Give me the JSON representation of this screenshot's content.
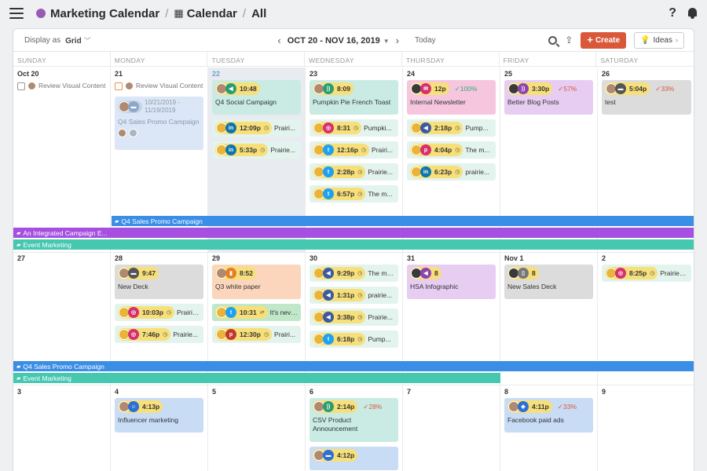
{
  "breadcrumb": {
    "root": "Marketing Calendar",
    "sep1": "/",
    "calendar": "Calendar",
    "sep2": "/",
    "view": "All"
  },
  "toolbar": {
    "display_as_label": "Display as",
    "display_mode": "Grid",
    "range": "OCT 20 - NOV 16, 2019",
    "today": "Today",
    "create": "Create",
    "ideas": "Ideas"
  },
  "days": [
    "SUNDAY",
    "MONDAY",
    "TUESDAY",
    "WEDNESDAY",
    "THURSDAY",
    "FRIDAY",
    "SATURDAY"
  ],
  "week1": {
    "dates": [
      "Oct 20",
      "21",
      "22",
      "23",
      "24",
      "25",
      "26"
    ],
    "tasks": {
      "sun": "Review Visual Content",
      "mon": "Review Visual Content"
    },
    "promo_card": {
      "dates": "10/21/2019 - 11/19/2019",
      "title": "Q4 Sales Promo Campaign"
    },
    "tue": [
      {
        "time": "10:48",
        "title": "Q4 Social Campaign"
      },
      {
        "time": "12:09p",
        "text": "Prairi..."
      },
      {
        "time": "5:33p",
        "text": "Prairie..."
      }
    ],
    "wed": [
      {
        "time": "8:09",
        "title": "Pumpkin Pie French Toast"
      },
      {
        "time": "8:31",
        "text": "Pumpki..."
      },
      {
        "time": "12:16p",
        "text": "Prairi..."
      },
      {
        "time": "2:28p",
        "text": "Prairie..."
      },
      {
        "time": "6:57p",
        "text": "The m..."
      }
    ],
    "thu": [
      {
        "time": "12p",
        "pct": "100%",
        "title": "Internal Newsletter"
      },
      {
        "time": "2:18p",
        "text": "Pump..."
      },
      {
        "time": "4:04p",
        "text": "The m..."
      },
      {
        "time": "6:23p",
        "text": "prairie..."
      }
    ],
    "fri": [
      {
        "time": "3:30p",
        "pct": "57%",
        "title": "Better Blog Posts"
      }
    ],
    "sat": [
      {
        "time": "5:04p",
        "pct": "33%",
        "title": "test"
      }
    ],
    "banners": [
      "Q4 Sales Promo Campaign",
      "An Integrated Campaign E...",
      "Event Marketing"
    ]
  },
  "week2": {
    "dates": [
      "27",
      "28",
      "29",
      "30",
      "31",
      "Nov 1",
      "2"
    ],
    "mon": [
      {
        "time": "9:47",
        "title": "New Deck"
      },
      {
        "time": "10:03p",
        "text": "Prairie..."
      },
      {
        "time": "7:46p",
        "text": "Prairie..."
      }
    ],
    "tue": [
      {
        "time": "8:52",
        "title": "Q3 white paper"
      },
      {
        "time": "10:31",
        "text": "It's never ..."
      },
      {
        "time": "12:30p",
        "text": "Prairi..."
      }
    ],
    "wed": [
      {
        "time": "9:29p",
        "text": "The mo..."
      },
      {
        "time": "1:31p",
        "text": "prairie..."
      },
      {
        "time": "3:38p",
        "text": "Prairie..."
      },
      {
        "time": "6:18p",
        "text": "Pump..."
      }
    ],
    "thu": [
      {
        "time": "8",
        "title": "HSA Infographic"
      }
    ],
    "fri": [
      {
        "time": "8",
        "title": "New Sales Deck"
      }
    ],
    "sat": [
      {
        "time": "8:25p",
        "text": "Prairies..."
      }
    ],
    "banners": [
      "Q4 Sales Promo Campaign",
      "Event Marketing"
    ]
  },
  "week3": {
    "dates": [
      "3",
      "4",
      "5",
      "6",
      "7",
      "8",
      "9"
    ],
    "mon": [
      {
        "time": "4:13p",
        "title": "Influencer marketing"
      }
    ],
    "wed": [
      {
        "time": "2:14p",
        "pct": "28%",
        "title": "CSV Product Announcement"
      },
      {
        "time": "4:12p"
      }
    ],
    "fri": [
      {
        "time": "4:11p",
        "pct": "33%",
        "title": "Facebook paid ads"
      }
    ]
  },
  "colors": {
    "accent": "#d9583a",
    "banner_blue": "#3a8ee6",
    "banner_purple": "#a64fe0",
    "banner_teal": "#45c7b0",
    "percent_green": "#3aa876",
    "percent_red": "#d9583a"
  },
  "icons": [
    "hamburger-icon",
    "calendar-icon",
    "help-icon",
    "bell-icon",
    "search-icon",
    "share-icon",
    "lightbulb-icon",
    "folder-icon",
    "clock-icon",
    "check-icon"
  ]
}
